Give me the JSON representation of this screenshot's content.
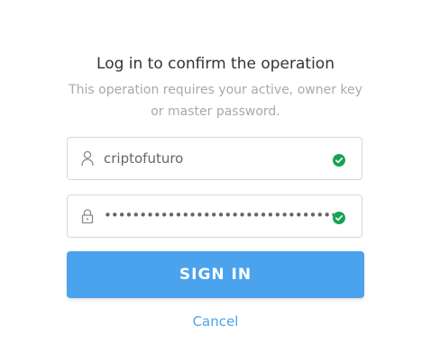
{
  "dialog": {
    "title": "Log in to confirm the operation",
    "subtitle": "This operation requires your active, owner key or master password."
  },
  "username_field": {
    "value": "criptofuturo",
    "icon": "user-icon",
    "status_icon": "check-circle-icon",
    "status_color": "#1aa355"
  },
  "password_field": {
    "masked_value": "••••••••••••••••••••••••••••••••••",
    "icon": "lock-icon",
    "status_icon": "check-circle-icon",
    "status_color": "#1aa355"
  },
  "actions": {
    "sign_in_label": "SIGN IN",
    "cancel_label": "Cancel",
    "accent_color": "#4ba3ee"
  }
}
